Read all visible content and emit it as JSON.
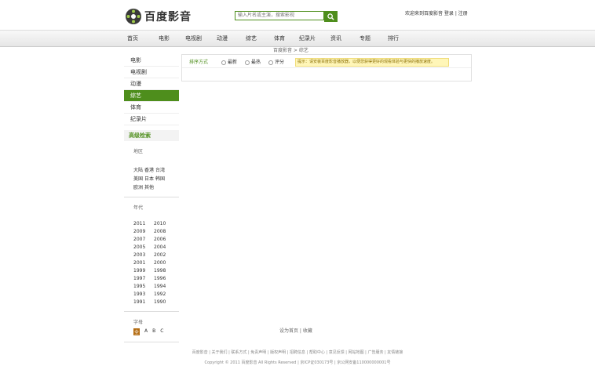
{
  "header": {
    "logo_text": "百度影音",
    "search_placeholder": "输入片名或主演，搜索影视",
    "login_text": "欢迎来到百度影音 登录 | 注册"
  },
  "nav": [
    "首页",
    "电影",
    "电视剧",
    "动漫",
    "综艺",
    "体育",
    "纪录片",
    "资讯",
    "专题",
    "排行"
  ],
  "breadcrumb": "百度影音 > 综艺",
  "sidebar": {
    "categories": [
      "电影",
      "电视剧",
      "动漫",
      "综艺",
      "体育",
      "纪录片"
    ],
    "active_index": 3,
    "advanced_title": "高级检索",
    "area_label": "地区",
    "areas": [
      "大陆",
      "香港",
      "台湾",
      "美国",
      "日本",
      "韩国",
      "欧洲",
      "其他"
    ],
    "year_label": "年代",
    "years": [
      "2011",
      "2010",
      "2009",
      "2008",
      "2007",
      "2006",
      "2005",
      "2004",
      "2003",
      "2002",
      "2001",
      "2000",
      "1999",
      "1998",
      "1997",
      "1996",
      "1995",
      "1994",
      "1993",
      "1992",
      "1991",
      "1990"
    ],
    "letter_label": "字母",
    "letters": [
      "全",
      "A",
      "B",
      "C"
    ]
  },
  "main": {
    "sort_label": "排序方式",
    "sort_options": [
      "最新",
      "最热",
      "评分"
    ],
    "notice": "提示：请安装百度影音播放器，以便您获得更好的观看体验与更快的播放速度。"
  },
  "footer": {
    "link": "设为首页 | 收藏",
    "line1": "百度影音 | 关于我们 | 联系方式 | 免责声明 | 版权声明 | 招聘信息 | 帮助中心 | 意见反馈 | 网站地图 | 广告服务 | 友情链接",
    "line2": "Copyright © 2011 百度影音 All Rights Reserved | 京ICP证030173号 | 京公网安备110000000001号"
  },
  "colors": {
    "accent": "#4e8e1c",
    "notice_bg": "#fff6b8"
  }
}
